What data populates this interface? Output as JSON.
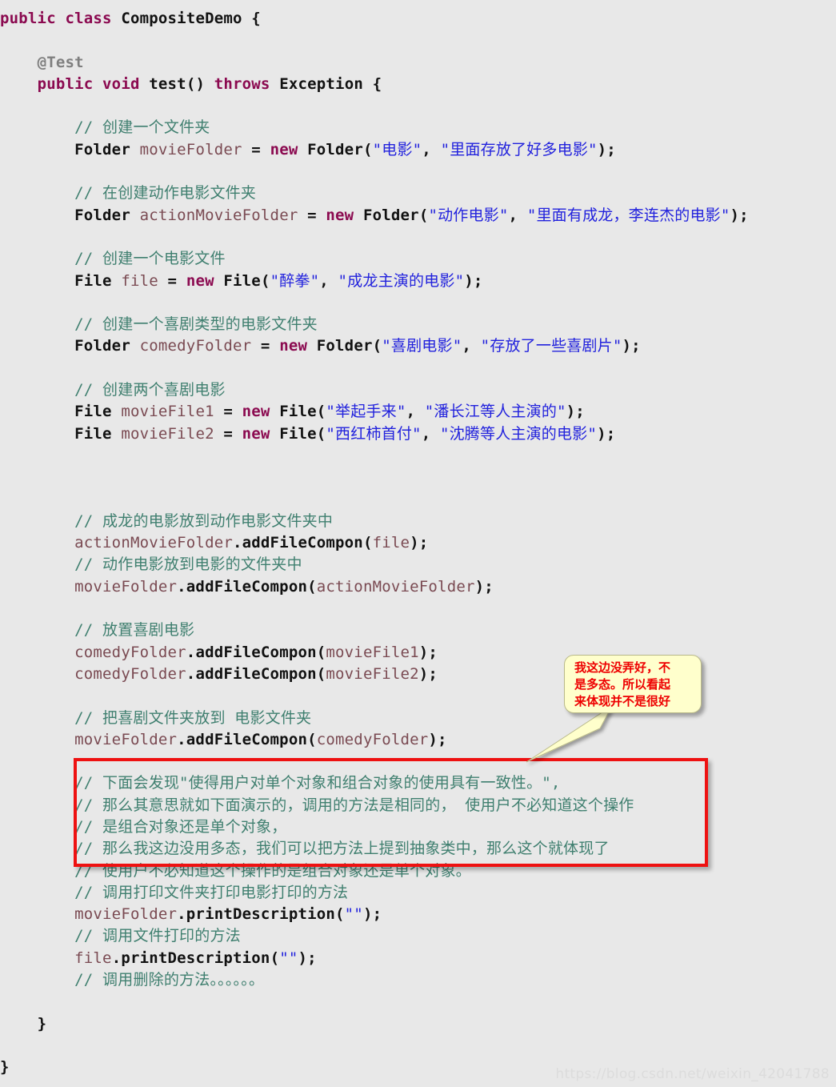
{
  "page": {
    "background_color": "#e8e8e8",
    "language": "java",
    "watermark": "https://blog.csdn.net/weixin_42041788"
  },
  "colors": {
    "keyword": "#8b0a50",
    "type": "#111111",
    "variable": "#7a4a52",
    "method": "#111111",
    "string": "#2222dd",
    "comment": "#3f7f6f",
    "annotation": "#7f7f7f",
    "highlight_line": "#e6eefb",
    "callout_fill": "#ffffcc",
    "callout_text": "#ee0000",
    "red_box_border": "#ee1111",
    "watermark": "#dcdcdc"
  },
  "code": {
    "lines": [
      {
        "indent": 0,
        "tokens": [
          {
            "t": "kw",
            "s": "public"
          },
          {
            "t": "pun",
            "s": " "
          },
          {
            "t": "kw",
            "s": "class"
          },
          {
            "t": "pun",
            "s": " "
          },
          {
            "t": "typ",
            "s": "CompositeDemo"
          },
          {
            "t": "pun",
            "s": " {"
          }
        ]
      },
      {
        "indent": 0,
        "tokens": []
      },
      {
        "indent": 1,
        "tokens": [
          {
            "t": "ann",
            "s": "@Test"
          }
        ]
      },
      {
        "indent": 1,
        "tokens": [
          {
            "t": "kw",
            "s": "public"
          },
          {
            "t": "pun",
            "s": " "
          },
          {
            "t": "kw",
            "s": "void"
          },
          {
            "t": "pun",
            "s": " "
          },
          {
            "t": "mth",
            "s": "test"
          },
          {
            "t": "pun",
            "s": "() "
          },
          {
            "t": "kw",
            "s": "throws"
          },
          {
            "t": "pun",
            "s": " "
          },
          {
            "t": "typ",
            "s": "Exception"
          },
          {
            "t": "pun",
            "s": " {"
          }
        ]
      },
      {
        "indent": 0,
        "tokens": []
      },
      {
        "indent": 2,
        "tokens": [
          {
            "t": "cmt",
            "s": "// 创建一个文件夹"
          }
        ]
      },
      {
        "indent": 2,
        "tokens": [
          {
            "t": "typ",
            "s": "Folder"
          },
          {
            "t": "pun",
            "s": " "
          },
          {
            "t": "var",
            "s": "movieFolder"
          },
          {
            "t": "pun",
            "s": " = "
          },
          {
            "t": "kw",
            "s": "new"
          },
          {
            "t": "pun",
            "s": " "
          },
          {
            "t": "typ",
            "s": "Folder"
          },
          {
            "t": "pun",
            "s": "("
          },
          {
            "t": "str",
            "s": "\"电影\""
          },
          {
            "t": "pun",
            "s": ", "
          },
          {
            "t": "str",
            "s": "\"里面存放了好多电影\""
          },
          {
            "t": "pun",
            "s": ");"
          }
        ]
      },
      {
        "indent": 0,
        "tokens": []
      },
      {
        "indent": 2,
        "tokens": [
          {
            "t": "cmt",
            "s": "// 在创建动作电影文件夹"
          }
        ]
      },
      {
        "indent": 2,
        "tokens": [
          {
            "t": "typ",
            "s": "Folder"
          },
          {
            "t": "pun",
            "s": " "
          },
          {
            "t": "var",
            "s": "actionMovieFolder"
          },
          {
            "t": "pun",
            "s": " = "
          },
          {
            "t": "kw",
            "s": "new"
          },
          {
            "t": "pun",
            "s": " "
          },
          {
            "t": "typ",
            "s": "Folder"
          },
          {
            "t": "pun",
            "s": "("
          },
          {
            "t": "str",
            "s": "\"动作电影\""
          },
          {
            "t": "pun",
            "s": ", "
          },
          {
            "t": "str",
            "s": "\"里面有成龙，李连杰的电影\""
          },
          {
            "t": "pun",
            "s": ");"
          }
        ]
      },
      {
        "indent": 0,
        "tokens": []
      },
      {
        "indent": 2,
        "tokens": [
          {
            "t": "cmt",
            "s": "// 创建一个电影文件"
          }
        ]
      },
      {
        "indent": 2,
        "tokens": [
          {
            "t": "typ",
            "s": "File"
          },
          {
            "t": "pun",
            "s": " "
          },
          {
            "t": "var",
            "s": "file"
          },
          {
            "t": "pun",
            "s": " = "
          },
          {
            "t": "kw",
            "s": "new"
          },
          {
            "t": "pun",
            "s": " "
          },
          {
            "t": "typ",
            "s": "File"
          },
          {
            "t": "pun",
            "s": "("
          },
          {
            "t": "str",
            "s": "\"醉拳\""
          },
          {
            "t": "pun",
            "s": ", "
          },
          {
            "t": "str",
            "s": "\"成龙主演的电影\""
          },
          {
            "t": "pun",
            "s": ");"
          }
        ]
      },
      {
        "indent": 0,
        "tokens": []
      },
      {
        "indent": 2,
        "tokens": [
          {
            "t": "cmt",
            "s": "// 创建一个喜剧类型的电影文件夹"
          }
        ]
      },
      {
        "indent": 2,
        "tokens": [
          {
            "t": "typ",
            "s": "Folder"
          },
          {
            "t": "pun",
            "s": " "
          },
          {
            "t": "var",
            "s": "comedyFolder"
          },
          {
            "t": "pun",
            "s": " = "
          },
          {
            "t": "kw",
            "s": "new"
          },
          {
            "t": "pun",
            "s": " "
          },
          {
            "t": "typ",
            "s": "Folder"
          },
          {
            "t": "pun",
            "s": "("
          },
          {
            "t": "str",
            "s": "\"喜剧电影\""
          },
          {
            "t": "pun",
            "s": ", "
          },
          {
            "t": "str",
            "s": "\"存放了一些喜剧片\""
          },
          {
            "t": "pun",
            "s": ");"
          }
        ]
      },
      {
        "indent": 0,
        "tokens": []
      },
      {
        "indent": 2,
        "tokens": [
          {
            "t": "cmt",
            "s": "// 创建两个喜剧电影"
          }
        ]
      },
      {
        "indent": 2,
        "tokens": [
          {
            "t": "typ",
            "s": "File"
          },
          {
            "t": "pun",
            "s": " "
          },
          {
            "t": "var",
            "s": "movieFile1"
          },
          {
            "t": "pun",
            "s": " = "
          },
          {
            "t": "kw",
            "s": "new"
          },
          {
            "t": "pun",
            "s": " "
          },
          {
            "t": "typ",
            "s": "File"
          },
          {
            "t": "pun",
            "s": "("
          },
          {
            "t": "str",
            "s": "\"举起手来\""
          },
          {
            "t": "pun",
            "s": ", "
          },
          {
            "t": "str",
            "s": "\"潘长江等人主演的\""
          },
          {
            "t": "pun",
            "s": ");"
          }
        ]
      },
      {
        "indent": 2,
        "tokens": [
          {
            "t": "typ",
            "s": "File"
          },
          {
            "t": "pun",
            "s": " "
          },
          {
            "t": "var",
            "s": "movieFile2"
          },
          {
            "t": "pun",
            "s": " = "
          },
          {
            "t": "kw",
            "s": "new"
          },
          {
            "t": "pun",
            "s": " "
          },
          {
            "t": "typ",
            "s": "File"
          },
          {
            "t": "pun",
            "s": "("
          },
          {
            "t": "str",
            "s": "\"西红柿首付\""
          },
          {
            "t": "pun",
            "s": ", "
          },
          {
            "t": "str",
            "s": "\"沈腾等人主演的电影\""
          },
          {
            "t": "pun",
            "s": ");"
          }
        ]
      },
      {
        "indent": 0,
        "tokens": []
      },
      {
        "indent": 0,
        "tokens": []
      },
      {
        "indent": 0,
        "tokens": []
      },
      {
        "indent": 2,
        "tokens": [
          {
            "t": "cmt",
            "s": "// 成龙的电影放到动作电影文件夹中"
          }
        ]
      },
      {
        "indent": 2,
        "tokens": [
          {
            "t": "var",
            "s": "actionMovieFolder"
          },
          {
            "t": "pun",
            "s": "."
          },
          {
            "t": "mth",
            "s": "addFileCompon"
          },
          {
            "t": "pun",
            "s": "("
          },
          {
            "t": "var",
            "s": "file"
          },
          {
            "t": "pun",
            "s": ");"
          }
        ]
      },
      {
        "indent": 2,
        "tokens": [
          {
            "t": "cmt",
            "s": "// 动作电影放到电影的文件夹中"
          }
        ]
      },
      {
        "indent": 2,
        "tokens": [
          {
            "t": "var",
            "s": "movieFolder"
          },
          {
            "t": "pun",
            "s": "."
          },
          {
            "t": "mth",
            "s": "addFileCompon"
          },
          {
            "t": "pun",
            "s": "("
          },
          {
            "t": "var",
            "s": "actionMovieFolder"
          },
          {
            "t": "pun",
            "s": ");"
          }
        ]
      },
      {
        "indent": 0,
        "tokens": []
      },
      {
        "indent": 2,
        "tokens": [
          {
            "t": "cmt",
            "s": "// 放置喜剧电影"
          }
        ]
      },
      {
        "indent": 2,
        "tokens": [
          {
            "t": "var",
            "s": "comedyFolder"
          },
          {
            "t": "pun",
            "s": "."
          },
          {
            "t": "mth",
            "s": "addFileCompon"
          },
          {
            "t": "pun",
            "s": "("
          },
          {
            "t": "var",
            "s": "movieFile1"
          },
          {
            "t": "pun",
            "s": ");"
          }
        ]
      },
      {
        "indent": 2,
        "tokens": [
          {
            "t": "var",
            "s": "comedyFolder"
          },
          {
            "t": "pun",
            "s": "."
          },
          {
            "t": "mth",
            "s": "addFileCompon"
          },
          {
            "t": "pun",
            "s": "("
          },
          {
            "t": "var",
            "s": "movieFile2"
          },
          {
            "t": "pun",
            "s": ");"
          }
        ]
      },
      {
        "indent": 0,
        "tokens": []
      },
      {
        "indent": 2,
        "tokens": [
          {
            "t": "cmt",
            "s": "// 把喜剧文件夹放到 电影文件夹"
          }
        ]
      },
      {
        "indent": 2,
        "tokens": [
          {
            "t": "var",
            "s": "movieFolder"
          },
          {
            "t": "pun",
            "s": "."
          },
          {
            "t": "mth",
            "s": "addFileCompon"
          },
          {
            "t": "pun",
            "s": "("
          },
          {
            "t": "var",
            "s": "comedyFolder"
          },
          {
            "t": "pun",
            "s": ");"
          }
        ]
      },
      {
        "indent": 0,
        "tokens": []
      },
      {
        "indent": 2,
        "tokens": [
          {
            "t": "cmt",
            "s": "// 下面会发现\"使得用户对单个对象和组合对象的使用具有一致性。\","
          }
        ]
      },
      {
        "indent": 2,
        "tokens": [
          {
            "t": "cmt",
            "s": "// 那么其意思就如下面演示的，调用的方法是相同的， 使用户不必知道这个操作"
          }
        ]
      },
      {
        "indent": 2,
        "tokens": [
          {
            "t": "cmt",
            "s": "// 是组合对象还是单个对象，"
          }
        ]
      },
      {
        "indent": 2,
        "tokens": [
          {
            "t": "cmt",
            "s": "// 那么我这边没用多态，我们可以把方法上提到抽象类中，那么这个就体现了"
          }
        ]
      },
      {
        "indent": 2,
        "highlight": true,
        "tokens": [
          {
            "t": "cmt",
            "s": "// 使用户不必知道这个操作的是组合对象还是单个对象。"
          }
        ]
      },
      {
        "indent": 2,
        "tokens": [
          {
            "t": "cmt",
            "s": "// 调用打印文件夹打印电影打印的方法"
          }
        ]
      },
      {
        "indent": 2,
        "tokens": [
          {
            "t": "var",
            "s": "movieFolder"
          },
          {
            "t": "pun",
            "s": "."
          },
          {
            "t": "mth",
            "s": "printDescription"
          },
          {
            "t": "pun",
            "s": "("
          },
          {
            "t": "str",
            "s": "\"\""
          },
          {
            "t": "pun",
            "s": ");"
          }
        ]
      },
      {
        "indent": 2,
        "tokens": [
          {
            "t": "cmt",
            "s": "// 调用文件打印的方法"
          }
        ]
      },
      {
        "indent": 2,
        "tokens": [
          {
            "t": "var",
            "s": "file"
          },
          {
            "t": "pun",
            "s": "."
          },
          {
            "t": "mth",
            "s": "printDescription"
          },
          {
            "t": "pun",
            "s": "("
          },
          {
            "t": "str",
            "s": "\"\""
          },
          {
            "t": "pun",
            "s": ");"
          }
        ]
      },
      {
        "indent": 2,
        "tokens": [
          {
            "t": "cmt",
            "s": "// 调用删除的方法。。。。。。"
          }
        ]
      },
      {
        "indent": 0,
        "tokens": []
      },
      {
        "indent": 1,
        "tokens": [
          {
            "t": "pun",
            "s": "}"
          }
        ]
      },
      {
        "indent": 0,
        "tokens": []
      },
      {
        "indent": 0,
        "tokens": [
          {
            "t": "pun",
            "s": "}"
          }
        ]
      }
    ]
  },
  "annotations": {
    "callout": {
      "text": "我这边没弄好，不\n是多态。所以看起\n来体现并不是很好",
      "fill": "#ffffcc",
      "text_color": "#ee0000"
    },
    "red_box": {
      "label": "red-highlight-rectangle",
      "border_color": "#ee1111"
    }
  }
}
